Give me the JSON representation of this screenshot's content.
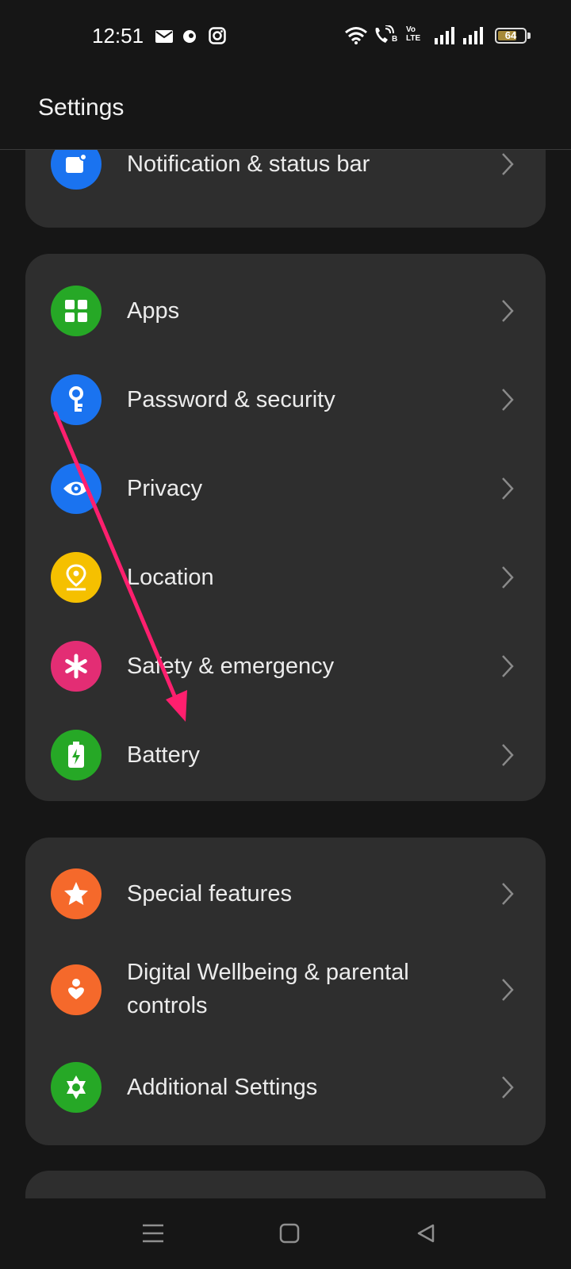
{
  "status_bar": {
    "time": "12:51",
    "battery_level": "64",
    "network_label": "Vo LTE",
    "sim_indicator": "B",
    "icons": [
      "mail-icon",
      "notification-icon",
      "instagram-icon",
      "wifi-icon",
      "call-icon",
      "volte-icon",
      "signal-icon",
      "signal-icon",
      "battery-icon"
    ]
  },
  "header": {
    "title": "Settings"
  },
  "sections": [
    {
      "items": [
        {
          "label": "Notification & status bar",
          "icon": "notification-bar-icon",
          "color": "#1a73f0"
        }
      ]
    },
    {
      "items": [
        {
          "label": "Apps",
          "icon": "apps-grid-icon",
          "color": "#26a826"
        },
        {
          "label": "Password & security",
          "icon": "key-icon",
          "color": "#1a73f0"
        },
        {
          "label": "Privacy",
          "icon": "eye-icon",
          "color": "#1a73f0"
        },
        {
          "label": "Location",
          "icon": "location-pin-icon",
          "color": "#f5c000"
        },
        {
          "label": "Safety & emergency",
          "icon": "asterisk-icon",
          "color": "#e32d74"
        },
        {
          "label": "Battery",
          "icon": "battery-charge-icon",
          "color": "#26a826"
        }
      ]
    },
    {
      "items": [
        {
          "label": "Special features",
          "icon": "star-icon",
          "color": "#f5692b"
        },
        {
          "label": "Digital Wellbeing & parental controls",
          "icon": "heart-hand-icon",
          "color": "#f5692b"
        },
        {
          "label": "Additional Settings",
          "icon": "gear-icon",
          "color": "#26a826"
        }
      ]
    }
  ],
  "annotation": {
    "type": "arrow",
    "color": "#ff1f6e",
    "from_item": "Password & security",
    "to_item": "Battery"
  },
  "nav_bar": {
    "buttons": [
      "menu-icon",
      "home-icon",
      "back-icon"
    ]
  }
}
